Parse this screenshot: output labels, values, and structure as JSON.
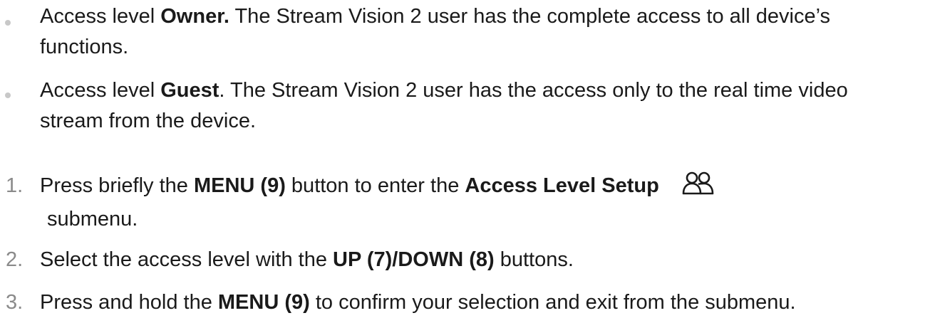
{
  "bullets": [
    {
      "prefix": "Access level ",
      "bold": "Owner.",
      "suffix": " The Stream Vision 2 user has the complete access to all device’s functions."
    },
    {
      "prefix": "Access level ",
      "bold": "Guest",
      "suffix": ". The Stream Vision 2 user has the access only to the real time video stream from the device."
    }
  ],
  "steps": [
    {
      "number": "1.",
      "t1": "Press briefly the ",
      "b1": "MENU (9)",
      "t2": " button to enter the ",
      "b2": "Access Level Setup",
      "icon": "people-icon",
      "t3": "submenu."
    },
    {
      "number": "2.",
      "t1": "Select the access level with the ",
      "b1": "UP (7)/DOWN (8)",
      "t2": " buttons."
    },
    {
      "number": "3.",
      "t1": "Press and hold the ",
      "b1": "MENU (9)",
      "t2": " to confirm your selection and exit from the submenu."
    }
  ]
}
